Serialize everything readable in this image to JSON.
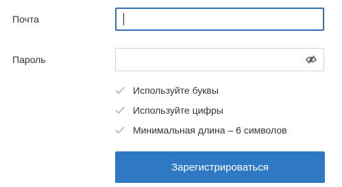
{
  "form": {
    "email": {
      "label": "Почта",
      "value": "",
      "placeholder": ""
    },
    "password": {
      "label": "Пароль",
      "value": "",
      "placeholder": "",
      "toggle_icon": "eye-slash-icon"
    },
    "rules": [
      {
        "text": "Используйте буквы",
        "icon": "check-icon"
      },
      {
        "text": "Используйте цифры",
        "icon": "check-icon"
      },
      {
        "text": "Минимальная длина – 6 символов",
        "icon": "check-icon"
      }
    ],
    "submit_label": "Зарегистрироваться"
  },
  "colors": {
    "accent": "#2f79c4",
    "focus_border": "#2f71b3",
    "border": "#cfd3d7",
    "check": "#b9bec4",
    "text": "#333333"
  }
}
